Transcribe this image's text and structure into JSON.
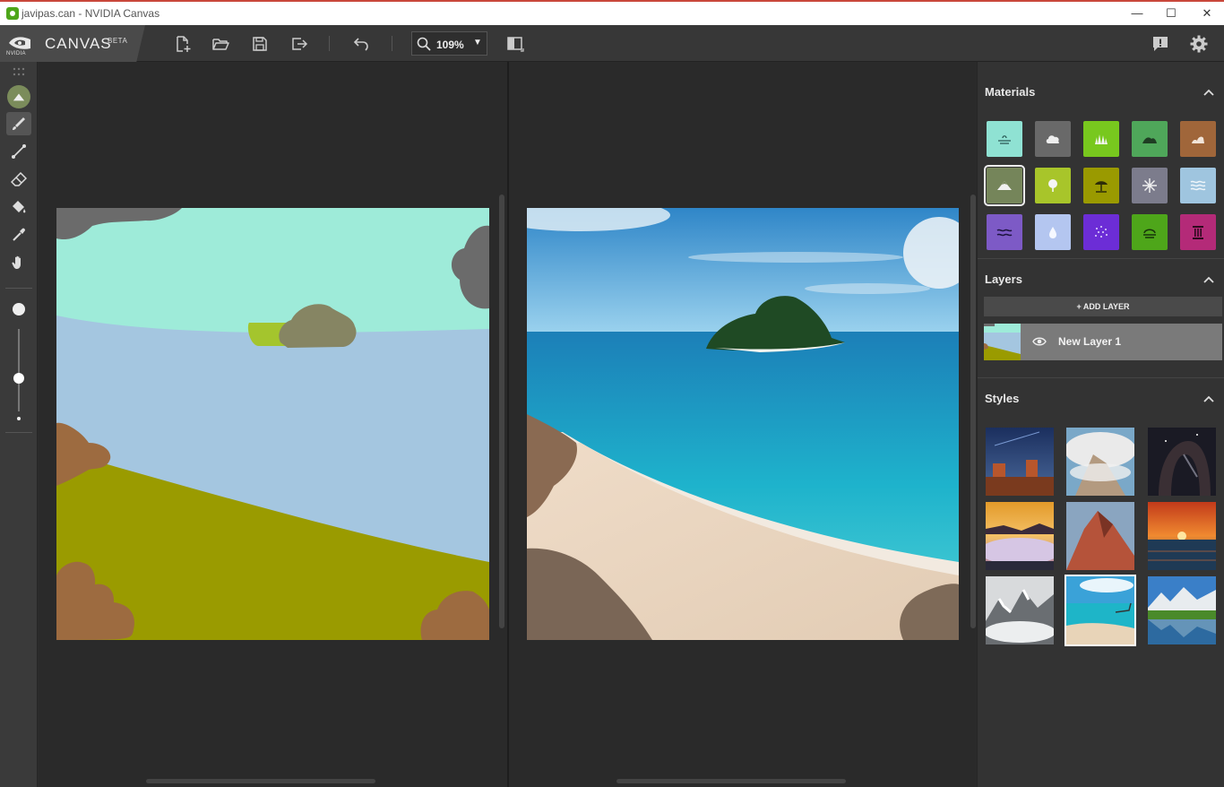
{
  "window": {
    "title": "javipas.can - NVIDIA Canvas",
    "minimize": "—",
    "maximize": "☐",
    "close": "✕"
  },
  "brand": {
    "vendor": "NVIDIA",
    "app_name": "CANVAS",
    "tag": "BETA"
  },
  "toolbar": {
    "buttons": [
      "new-file",
      "open-file",
      "save-file",
      "export",
      "undo",
      "compare-view"
    ],
    "zoom_value": "109%",
    "right_buttons": [
      "feedback",
      "settings"
    ]
  },
  "tools": [
    "material",
    "brush",
    "line",
    "eraser",
    "paint-bucket",
    "eyedropper",
    "pan"
  ],
  "panels": {
    "materials": {
      "title": "Materials",
      "items": [
        {
          "name": "sky",
          "color": "#8fe2d3"
        },
        {
          "name": "cloud",
          "color": "#696969"
        },
        {
          "name": "grass",
          "color": "#78c81e"
        },
        {
          "name": "hill",
          "color": "#4fa75a"
        },
        {
          "name": "dirt",
          "color": "#a0663a"
        },
        {
          "name": "mountain",
          "color": "#75855a",
          "selected": true
        },
        {
          "name": "bush",
          "color": "#a8c52a"
        },
        {
          "name": "beach",
          "color": "#9a9a00"
        },
        {
          "name": "snow",
          "color": "#7c7c8c"
        },
        {
          "name": "sea",
          "color": "#9fc5df"
        },
        {
          "name": "river",
          "color": "#7d5ac6"
        },
        {
          "name": "water",
          "color": "#b4c6f0"
        },
        {
          "name": "fog",
          "color": "#6c2dd6"
        },
        {
          "name": "lake",
          "color": "#4ea61a"
        },
        {
          "name": "stone",
          "color": "#b42a78"
        }
      ]
    },
    "layers": {
      "title": "Layers",
      "add_label": "+ ADD LAYER",
      "items": [
        {
          "name": "New Layer 1"
        }
      ]
    },
    "styles": {
      "title": "Styles",
      "selected_index": 7
    }
  }
}
